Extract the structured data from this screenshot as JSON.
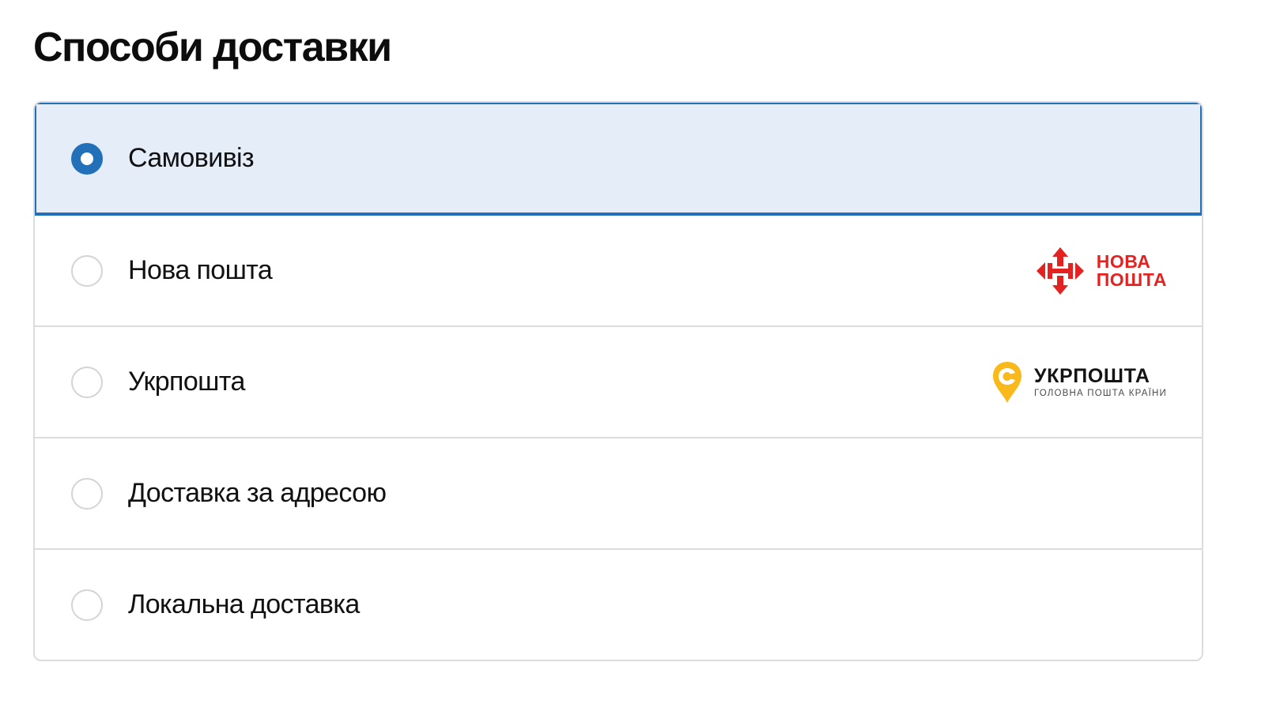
{
  "page": {
    "title": "Способи доставки"
  },
  "delivery_options": [
    {
      "label": "Самовивіз",
      "selected": true,
      "logo": null
    },
    {
      "label": "Нова пошта",
      "selected": false,
      "logo": {
        "name": "nova-poshta-logo",
        "line1": "НОВА",
        "line2": "ПОШТА",
        "color": "#E32321"
      }
    },
    {
      "label": "Укрпошта",
      "selected": false,
      "logo": {
        "name": "ukrposhta-logo",
        "title": "УКРПОШТА",
        "subtitle": "ГОЛОВНА ПОШТА КРАЇНИ",
        "color": "#F9B91B"
      }
    },
    {
      "label": "Доставка за адресою",
      "selected": false,
      "logo": null
    },
    {
      "label": "Локальна доставка",
      "selected": false,
      "logo": null
    }
  ],
  "colors": {
    "accent": "#2270B8",
    "selected_background": "#E5EEF8",
    "border": "#DCDCDC"
  }
}
